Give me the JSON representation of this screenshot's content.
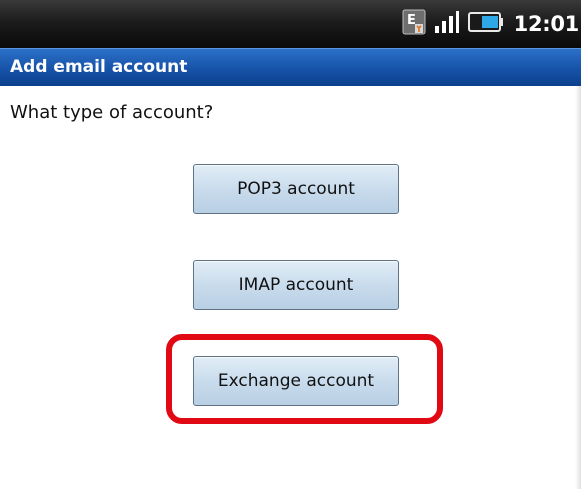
{
  "status_bar": {
    "time": "12:01",
    "icons": [
      "notification-e-icon",
      "signal-strength-icon",
      "battery-icon"
    ],
    "battery_level": 0.6
  },
  "title_bar": {
    "title": "Add email account"
  },
  "content": {
    "prompt": "What type of account?",
    "buttons": [
      {
        "label": "POP3 account"
      },
      {
        "label": "IMAP account"
      },
      {
        "label": "Exchange account"
      }
    ]
  },
  "colors": {
    "title_bar": "#1653a8",
    "highlight": "#e10a14",
    "button_fill": "#c9dced"
  }
}
